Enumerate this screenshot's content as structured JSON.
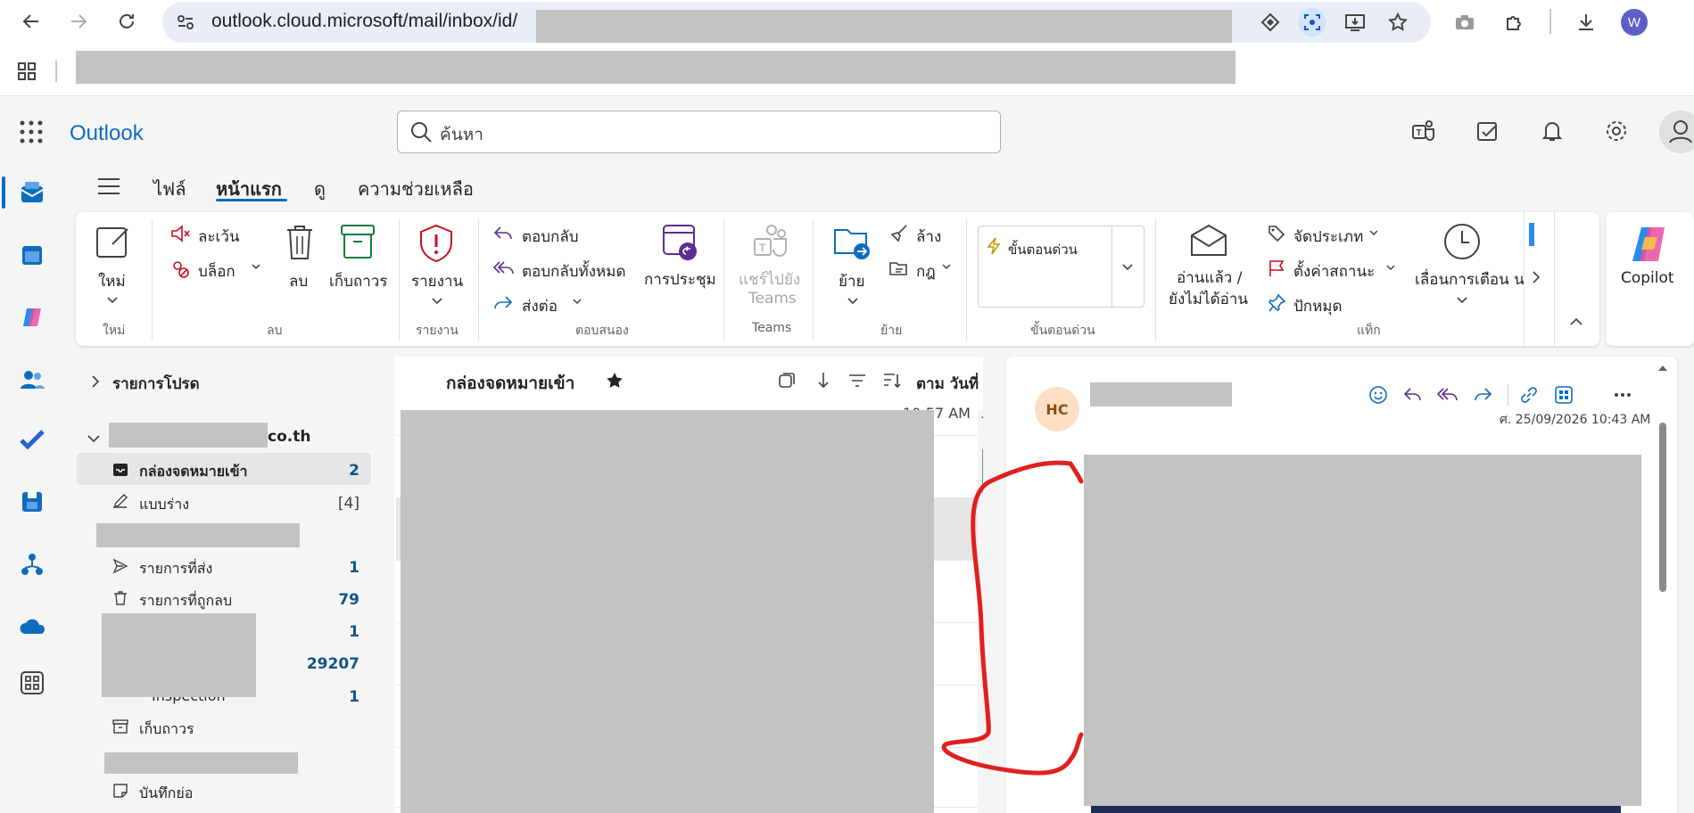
{
  "browser": {
    "url": "outlook.cloud.microsoft/mail/inbox/id/",
    "profile_initial": "W",
    "icons": [
      "back-icon",
      "forward-icon",
      "reload-icon",
      "site-info-icon",
      "extension-diamond-icon",
      "lens-icon",
      "install-app-icon",
      "bookmark-star-icon",
      "camera-icon",
      "extensions-icon",
      "download-icon",
      "apps-grid-icon"
    ]
  },
  "app": {
    "name": "Outlook",
    "search_placeholder": "ค้นหา"
  },
  "rail": [
    "mail-icon",
    "calendar-icon",
    "copilot-icon",
    "people-icon",
    "todo-icon",
    "files-icon",
    "org-icon",
    "onedrive-icon",
    "more-apps-icon"
  ],
  "tabs": [
    "ไฟล์",
    "หน้าแรก",
    "ดู",
    "ความช่วยเหลือ"
  ],
  "ribbon": {
    "new": {
      "label": "ใหม่",
      "group": "ใหม่"
    },
    "delete_group": {
      "ignore": "ละเว้น",
      "block": "บล็อก",
      "delete": "ลบ",
      "archive": "เก็บถาวร",
      "group": "ลบ"
    },
    "report": {
      "label": "รายงาน",
      "group": "รายงาน"
    },
    "respond": {
      "reply": "ตอบกลับ",
      "reply_all": "ตอบกลับทั้งหมด",
      "forward": "ส่งต่อ",
      "meeting": "การประชุม",
      "group": "ตอบสนอง"
    },
    "teams": {
      "label_1": "แชร์ไปยัง",
      "label_2": "Teams",
      "group": "Teams"
    },
    "move": {
      "move": "ย้าย",
      "sweep": "ล้าง",
      "rules": "กฎ",
      "group": "ย้าย"
    },
    "quicksteps": {
      "label": "ขั้นตอนด่วน",
      "group": "ขั้นตอนด่วน"
    },
    "tags": {
      "read_1": "อ่านแล้ว /",
      "read_2": "ยังไม่ได้อ่าน",
      "categorize": "จัดประเภท",
      "flag": "ตั้งค่าสถานะ",
      "pin": "ปักหมุด",
      "snooze": "เลื่อนการเตือน น",
      "group": "แท็ก"
    },
    "copilot": "Copilot"
  },
  "folders": {
    "favorites": "รายการโปรด",
    "account_suffix": "co.th",
    "items": [
      {
        "label": "กล่องจดหมายเข้า",
        "count": "2"
      },
      {
        "label": "แบบร่าง",
        "count": "[4]"
      },
      {
        "label": "รายการที่ส่ง",
        "count": "1"
      },
      {
        "label": "รายการที่ถูกลบ",
        "count": "79"
      },
      {
        "label": "",
        "count": "1"
      },
      {
        "label": "",
        "count": "29207"
      },
      {
        "label": "Inspection",
        "count": "1"
      },
      {
        "label": "เก็บถาวร",
        "count": ""
      },
      {
        "label": "บันทึกย่อ",
        "count": ""
      }
    ]
  },
  "message_list": {
    "title": "กล่องจดหมายเข้า",
    "sort": "ตาม วันที่",
    "first_row_time": "10:57 AM",
    "row_time_fragment": "M"
  },
  "reading": {
    "avatar_initials": "HC",
    "date": "ศ. 25/09/2026 10:43 AM"
  },
  "colors": {
    "brand": "#0f6cbd",
    "annotation": "#e02020"
  }
}
